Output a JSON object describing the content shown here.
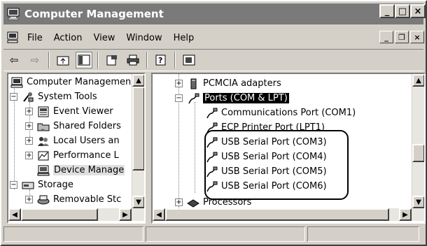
{
  "window": {
    "title": "Computer Management"
  },
  "caption_buttons": {
    "minimize": "_",
    "maximize": "□",
    "close": "×"
  },
  "menu": {
    "items": [
      "File",
      "Action",
      "View",
      "Window",
      "Help"
    ]
  },
  "mdi_buttons": {
    "minimize": "_",
    "restore": "❐",
    "close": "×"
  },
  "tree_left": [
    {
      "label": "Computer Managemen",
      "icon": "computer-icon"
    },
    {
      "label": "System Tools",
      "icon": "tools-icon"
    },
    {
      "label": "Event Viewer",
      "icon": "event-viewer-icon"
    },
    {
      "label": "Shared Folders",
      "icon": "folder-icon"
    },
    {
      "label": "Local Users an",
      "icon": "users-icon"
    },
    {
      "label": "Performance L",
      "icon": "performance-icon"
    },
    {
      "label": "Device Manage",
      "icon": "device-manager-icon"
    },
    {
      "label": "Storage",
      "icon": "storage-icon"
    },
    {
      "label": "Removable Stc",
      "icon": "removable-storage-icon"
    }
  ],
  "tree_right": [
    {
      "label": "PCMCIA adapters",
      "icon": "pcmcia-icon"
    },
    {
      "label": "Ports (COM & LPT)",
      "icon": "port-icon"
    },
    {
      "label": "Communications Port (COM1)",
      "icon": "port-icon"
    },
    {
      "label": "ECP Printer Port (LPT1)",
      "icon": "port-icon"
    },
    {
      "label": "USB Serial Port (COM3)",
      "icon": "port-icon"
    },
    {
      "label": "USB Serial Port (COM4)",
      "icon": "port-icon"
    },
    {
      "label": "USB Serial Port (COM5)",
      "icon": "port-icon"
    },
    {
      "label": "USB Serial Port (COM6)",
      "icon": "port-icon"
    },
    {
      "label": "Processors",
      "icon": "processor-icon"
    }
  ],
  "colors": {
    "title_bar": "#7a7a7a",
    "selection": "#000000",
    "callout": "#000000"
  }
}
